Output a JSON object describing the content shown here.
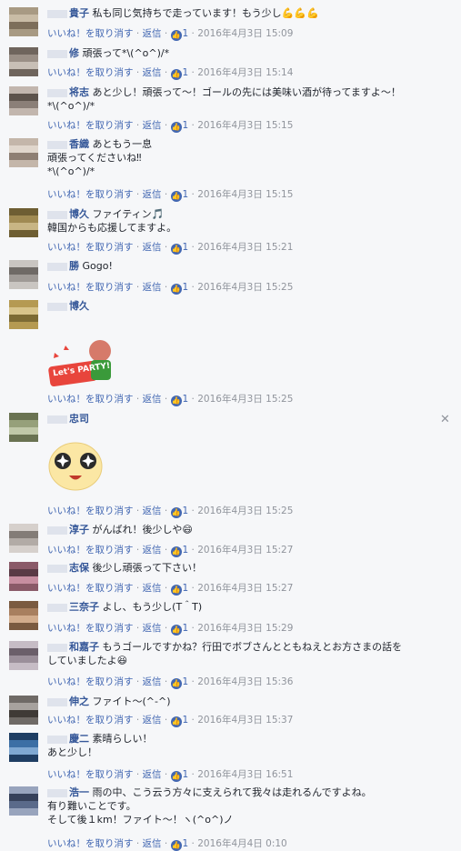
{
  "actions": {
    "unlike": "いいね！を取り消す",
    "sep": "·",
    "reply": "返信",
    "like_count": "1"
  },
  "comments": [
    {
      "name": "貴子",
      "text": "私も同じ気持ちで走っています！もう少し💪💪💪",
      "time": "2016年4月3日 15:09"
    },
    {
      "name": "修",
      "text": "頑張って*\\(^o^)/*",
      "time": "2016年4月3日 15:14"
    },
    {
      "name": "将志",
      "text": "あと少し！頑張って〜！ゴールの先には美味い酒が待ってますよ〜！\n*\\(^o^)/*",
      "time": "2016年4月3日 15:15"
    },
    {
      "name": "香織",
      "text": "あともう一息\n頑張ってくださいね‼︎\n*\\(^o^)/*",
      "time": "2016年4月3日 15:15"
    },
    {
      "name": "博久",
      "text": "ファイティン🎵\n韓国からも応援してますよ。",
      "time": "2016年4月3日 15:21"
    },
    {
      "name": "勝",
      "text": "Gogo!",
      "time": "2016年4月3日 15:25"
    },
    {
      "name": "博久",
      "text": "",
      "sticker_text": "Let's PARTY!",
      "time": "2016年4月3日 15:25"
    },
    {
      "name": "忠司",
      "text": "",
      "time": "2016年4月3日 15:25"
    },
    {
      "name": "淳子",
      "text": "がんばれ！後少しや😄",
      "time": "2016年4月3日 15:27"
    },
    {
      "name": "志保",
      "text": "後少し頑張って下さい！",
      "time": "2016年4月3日 15:27"
    },
    {
      "name": "三奈子",
      "text": "よし、もう少し(T＾T)",
      "time": "2016年4月3日 15:29"
    },
    {
      "name": "和嘉子",
      "text": "もうゴールですかね？行田でボブさんとともねえとお方さまの話を\nしていましたよ😆",
      "time": "2016年4月3日 15:36"
    },
    {
      "name": "伸之",
      "text": "ファイト〜(^-^)",
      "time": "2016年4月3日 15:37"
    },
    {
      "name": "慶二",
      "text": "素晴らしい！\nあと少し！",
      "time": "2016年4月3日 16:51"
    },
    {
      "name": "浩一",
      "text": "雨の中、こう云う方々に支えられて我々は走れるんですよね。\n有り難いことです。\nそして後１km！ファイト〜！ヽ(^o^)ノ",
      "time": "2016年4月4日 0:10"
    }
  ]
}
